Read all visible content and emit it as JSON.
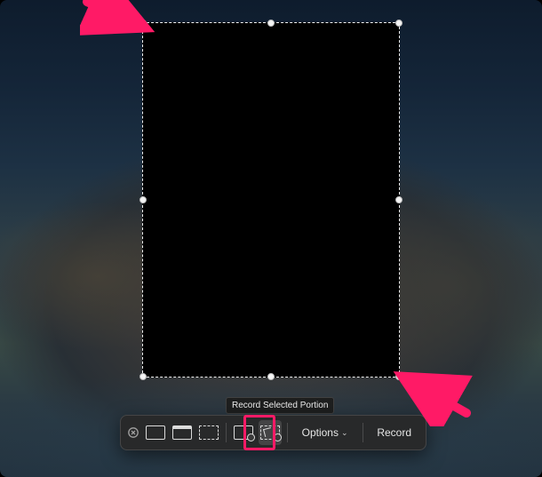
{
  "tooltip": {
    "text": "Record Selected Portion"
  },
  "toolbar": {
    "options_label": "Options",
    "record_label": "Record"
  },
  "annotations": {
    "arrow_color": "#ff1a66",
    "highlight_color": "#ff1a66"
  }
}
